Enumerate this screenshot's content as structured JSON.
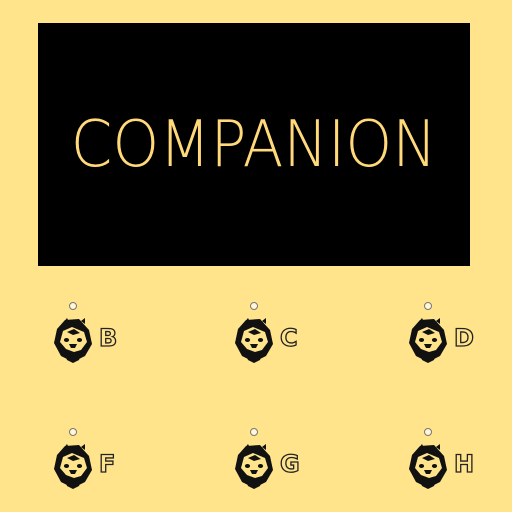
{
  "title": "COMPANION",
  "colors": {
    "background": "#ffe48c",
    "banner": "#000000",
    "title_text": "#ffd97a"
  },
  "options": [
    {
      "letter": "B",
      "icon": "companion-face-icon"
    },
    {
      "letter": "C",
      "icon": "companion-face-icon"
    },
    {
      "letter": "D",
      "icon": "companion-face-icon"
    },
    {
      "letter": "F",
      "icon": "companion-face-icon"
    },
    {
      "letter": "G",
      "icon": "companion-face-icon"
    },
    {
      "letter": "H",
      "icon": "companion-face-icon"
    }
  ]
}
